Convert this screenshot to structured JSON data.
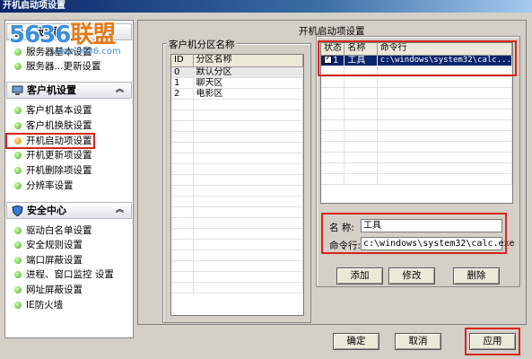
{
  "window": {
    "title": "开机启动项设置"
  },
  "watermark": {
    "logo": "5636",
    "logo_suffix": "联盟",
    "url": "www.5636.com"
  },
  "sidebar": {
    "groups": [
      {
        "label": "...设置",
        "items": [
          {
            "label": "服务器基本设置"
          },
          {
            "label": "服务器...更新设置"
          }
        ]
      },
      {
        "label": "客户机设置",
        "items": [
          {
            "label": "客户机基本设置"
          },
          {
            "label": "客户机换肤设置"
          },
          {
            "label": "开机启动项设置"
          },
          {
            "label": "开机更新项设置"
          },
          {
            "label": "开机删除项设置"
          },
          {
            "label": "分辨率设置"
          }
        ]
      },
      {
        "label": "安全中心",
        "items": [
          {
            "label": "驱动白名单设置"
          },
          {
            "label": "安全规则设置"
          },
          {
            "label": "端口屏蔽设置"
          },
          {
            "label": "进程、窗口监控 设置"
          },
          {
            "label": "网址屏蔽设置"
          },
          {
            "label": "IE防火墙"
          }
        ]
      }
    ]
  },
  "main": {
    "title": "开机启动项设置",
    "partition_panel": {
      "legend": "客户机分区名称",
      "columns": [
        "ID",
        "分区名称"
      ],
      "rows": [
        [
          "0",
          "默认分区"
        ],
        [
          "1",
          "聊天区"
        ],
        [
          "2",
          "电影区"
        ]
      ]
    },
    "startup_table": {
      "columns": [
        "状态",
        "名称",
        "命令行"
      ],
      "rows": [
        {
          "status": "1",
          "name": "工具",
          "command": "c:\\windows\\system32\\calc..."
        }
      ]
    },
    "form": {
      "name_label": "名  称:",
      "name_value": "工具",
      "cmd_label": "命令行:",
      "cmd_value": "c:\\windows\\system32\\calc.exe"
    },
    "buttons": {
      "add": "添加",
      "modify": "修改",
      "delete": "删除"
    }
  },
  "footer": {
    "ok": "确定",
    "cancel": "取消",
    "apply": "应用"
  },
  "colors": {
    "highlight": "#d9241a",
    "selection": "#0a246a"
  }
}
